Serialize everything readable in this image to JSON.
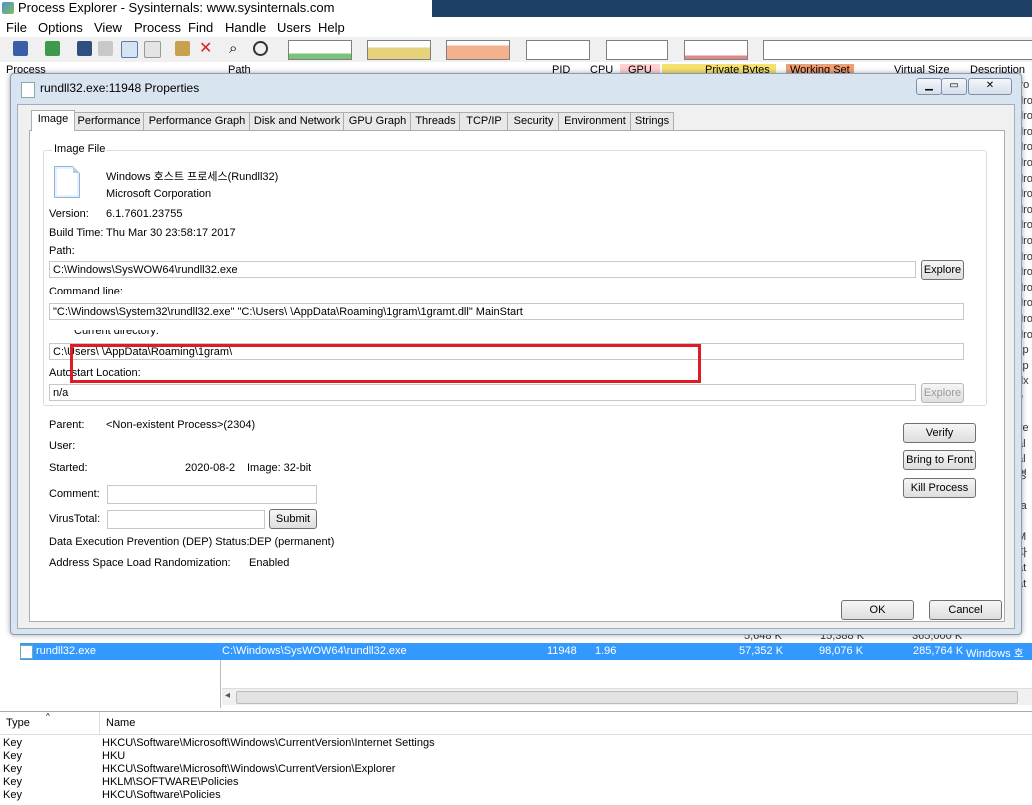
{
  "window": {
    "title": "Process Explorer - Sysinternals: www.sysinternals.com"
  },
  "menu": [
    "File",
    "Options",
    "View",
    "Process",
    "Find",
    "Handle",
    "Users",
    "Help"
  ],
  "columns": {
    "process": "Process",
    "path": "Path",
    "pid": "PID",
    "cpu": "CPU",
    "gpu": "GPU",
    "private_bytes": "Private Bytes",
    "working_set": "Working Set",
    "virtual_size": "Virtual Size",
    "description": "Description"
  },
  "selected_row": {
    "process": "rundll32.exe",
    "path": "C:\\Windows\\SysWOW64\\rundll32.exe",
    "pid": "11948",
    "cpu": "1.96",
    "private_bytes": "57,352 K",
    "working_set": "98,076 K",
    "virtual_size": "285,764 K",
    "description": "Windows 호"
  },
  "prev_row": {
    "private_bytes": "5,648 K",
    "working_set": "15,388 K",
    "virtual_size": "365,000 K"
  },
  "dialog": {
    "title": "rundll32.exe:11948 Properties",
    "tabs": [
      "Image",
      "Performance",
      "Performance Graph",
      "Disk and Network",
      "GPU Graph",
      "Threads",
      "TCP/IP",
      "Security",
      "Environment",
      "Strings"
    ],
    "active_tab": "Image",
    "image_file": {
      "legend": "Image File",
      "description": "Windows 호스트 프로세스(Rundll32)",
      "company": "Microsoft Corporation",
      "version_label": "Version:",
      "version": "6.1.7601.23755",
      "build_time_label": "Build Time:",
      "build_time": "Thu Mar 30 23:58:17 2017",
      "path_label": "Path:",
      "path": "C:\\Windows\\SysWOW64\\rundll32.exe",
      "explore_label": "Explore",
      "command_line_label": "Command line:",
      "command_line": "\"C:\\Windows\\System32\\rundll32.exe\" \"C:\\Users\\          \\AppData\\Roaming\\1gram\\1gramt.dll\" MainStart",
      "current_directory_label": "Current directory:",
      "current_directory": "C:\\Users\\          \\AppData\\Roaming\\1gram\\",
      "autostart_label": "Autostart Location:",
      "autostart": "n/a",
      "explore2_label": "Explore"
    },
    "parent_label": "Parent:",
    "parent": "<Non-existent Process>(2304)",
    "user_label": "User:",
    "started_label": "Started:",
    "started_date": "2020-08-2",
    "image_bits": "Image: 32-bit",
    "comment_label": "Comment:",
    "virustotal_label": "VirusTotal:",
    "submit_label": "Submit",
    "dep_label": "Data Execution Prevention (DEP) Status:",
    "dep_value": "DEP (permanent)",
    "aslr_label": "Address Space Load Randomization:",
    "aslr_value": "Enabled",
    "verify_label": "Verify",
    "bring_to_front_label": "Bring to Front",
    "kill_process_label": "Kill Process",
    "ok_label": "OK",
    "cancel_label": "Cancel"
  },
  "lower_pane": {
    "type_header": "Type",
    "name_header": "Name",
    "rows": [
      {
        "type": "Key",
        "name": "HKCU\\Software\\Microsoft\\Windows\\CurrentVersion\\Internet Settings"
      },
      {
        "type": "Key",
        "name": "HKU"
      },
      {
        "type": "Key",
        "name": "HKCU\\Software\\Microsoft\\Windows\\CurrentVersion\\Explorer"
      },
      {
        "type": "Key",
        "name": "HKLM\\SOFTWARE\\Policies"
      },
      {
        "type": "Key",
        "name": "HKCU\\Software\\Policies"
      }
    ]
  },
  "right_edge_text": "iro\ndro\ndro\ndro\ndro\ndro\ndro\ndro\ndro\ndro\ndro\ndro\ndro\ndro\ndro\ndro\ndro\nxp\nxp\ndx\ne\n\nye\nal\nal\n명\n\nra\n\nM\n파\nat\nat"
}
